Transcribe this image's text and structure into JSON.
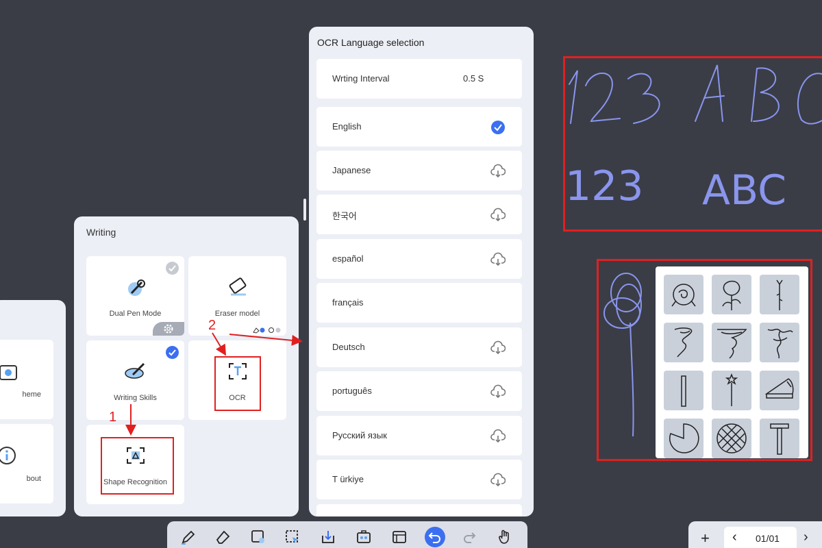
{
  "left_panel": {
    "items": [
      {
        "label": "heme",
        "icon": "settings-icon"
      },
      {
        "label": "bout",
        "icon": "info-icon"
      }
    ]
  },
  "writing_panel": {
    "title": "Writing",
    "tiles": [
      {
        "label": "Dual Pen Mode",
        "icon": "dual-pen-icon",
        "checked": false
      },
      {
        "label": "Eraser model",
        "icon": "eraser-icon"
      },
      {
        "label": "Writing Skills",
        "icon": "writing-skills-icon",
        "checked": true
      },
      {
        "label": "OCR",
        "icon": "ocr-icon"
      },
      {
        "label": "Shape Recognition",
        "icon": "shape-recognition-icon"
      }
    ],
    "annotations": [
      "1",
      "2"
    ]
  },
  "ocr_panel": {
    "title": "OCR Language selection",
    "interval": {
      "label": "Wrting Interval",
      "value": "0.5 S"
    },
    "languages": [
      {
        "label": "English",
        "status": "selected"
      },
      {
        "label": "Japanese",
        "status": "download"
      },
      {
        "label": "한국어",
        "status": "download"
      },
      {
        "label": "español",
        "status": "download"
      },
      {
        "label": "français",
        "status": "none"
      },
      {
        "label": "Deutsch",
        "status": "download"
      },
      {
        "label": "português",
        "status": "download"
      },
      {
        "label": "Русский язык",
        "status": "download"
      },
      {
        "label": "T ürkiye",
        "status": "download"
      }
    ]
  },
  "canvas": {
    "handwriting": "123 ABC",
    "recognized_numbers": "123",
    "recognized_letters": "ABC"
  },
  "toolbar": {
    "buttons": [
      "pen-icon",
      "eraser-icon",
      "clear-icon",
      "select-icon",
      "save-icon",
      "toolbox-icon",
      "board-icon",
      "undo-icon",
      "redo-icon",
      "hand-icon"
    ]
  },
  "pager": {
    "add": "+",
    "prev": "‹",
    "page": "01/01",
    "next": "›"
  },
  "colors": {
    "accent": "#3b6ff0",
    "annotation": "#e02020",
    "ink": "#8a95ee"
  }
}
